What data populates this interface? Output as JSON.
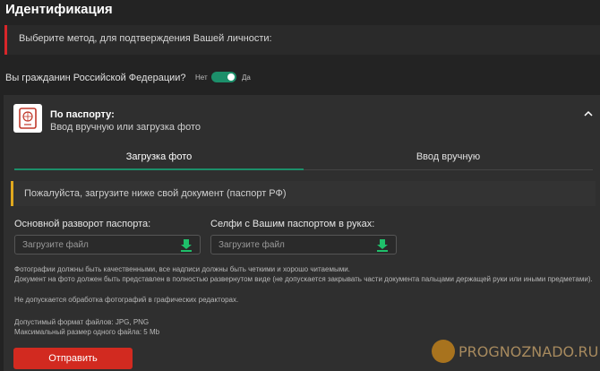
{
  "page_title": "Идентификация",
  "notice_text": "Выберите метод, для подтверждения Вашей личности:",
  "citizenship": {
    "question": "Вы гражданин Российской Федерации?",
    "no_label": "Нет",
    "yes_label": "Да",
    "selected": "Да"
  },
  "passport": {
    "title": "По паспорту:",
    "subtitle": "Ввод вручную или загрузка фото",
    "icon": "passport-icon"
  },
  "tabs": [
    {
      "label": "Загрузка фото",
      "active": true
    },
    {
      "label": "Ввод вручную",
      "active": false
    }
  ],
  "warning_text": "Пожалуйста, загрузите ниже свой документ (паспорт РФ)",
  "fields": {
    "main_spread_label": "Основной разворот паспорта:",
    "main_spread_placeholder": "Загрузите файл",
    "selfie_label": "Селфи с Вашим паспортом в руках:",
    "selfie_placeholder": "Загрузите файл"
  },
  "info": {
    "line1": "Фотографии должны быть качественными, все надписи должны быть четкими и хорошо читаемыми.",
    "line2": "Документ на фото должен быть представлен в полностью развернутом виде (не допускается закрывать части документа пальцами держащей руки или иными предметами).",
    "line3": "Не допускается обработка фотографий в графических редакторах.",
    "line4": "Допустимый формат файлов: JPG, PNG",
    "line5": "Максимальный размер одного файла: 5 Mb"
  },
  "submit_label": "Отправить",
  "watermark": "PROGNOZNADO.RU",
  "colors": {
    "accent": "#1c8f6a",
    "danger": "#d22a20",
    "warning": "#e0a81e",
    "background": "#232323"
  }
}
